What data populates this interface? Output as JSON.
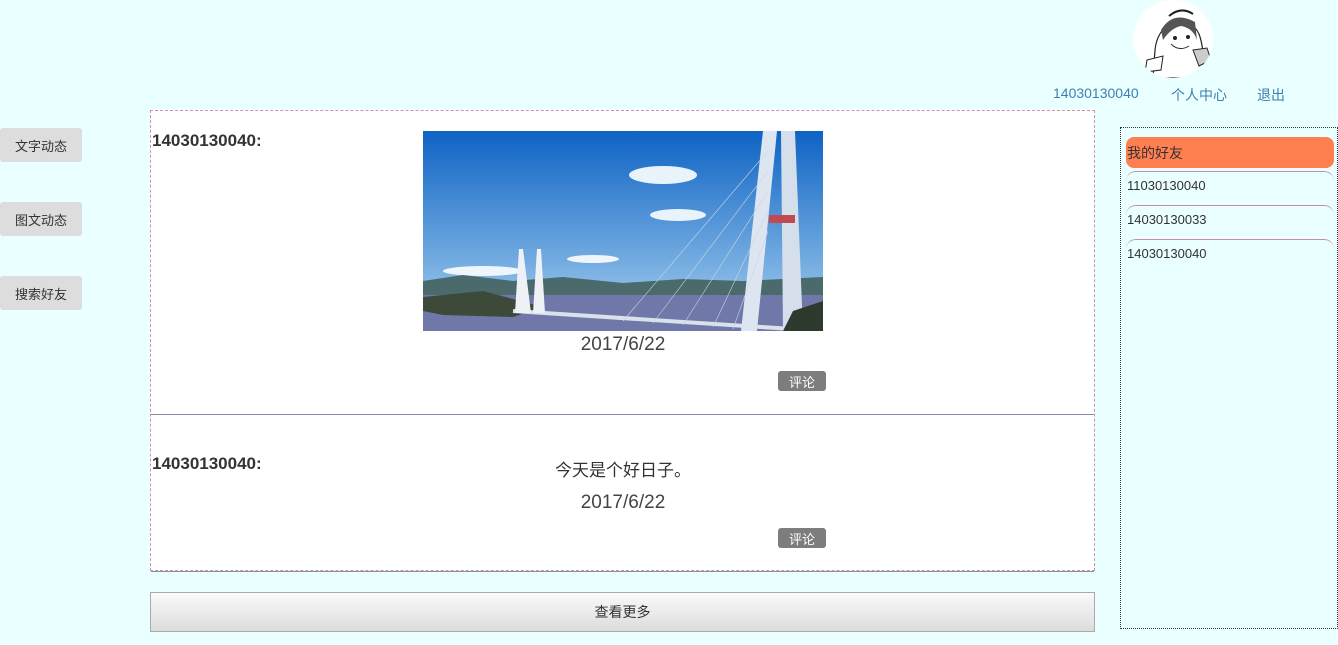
{
  "header": {
    "username": "14030130040",
    "profile_label": "个人中心",
    "logout_label": "退出"
  },
  "sidebar": {
    "items": [
      {
        "label": "文字动态"
      },
      {
        "label": "图文动态"
      },
      {
        "label": "搜索好友"
      }
    ]
  },
  "feed": {
    "posts": [
      {
        "author": "14030130040:",
        "image": "bridge-photo",
        "date": "2017/6/22",
        "comment_label": "评论"
      },
      {
        "author": "14030130040:",
        "text": "今天是个好日子。",
        "date": "2017/6/22",
        "comment_label": "评论"
      }
    ],
    "more_label": "查看更多"
  },
  "friends": {
    "title": "我的好友",
    "list": [
      "11030130040",
      "14030130033",
      "14030130040"
    ]
  }
}
